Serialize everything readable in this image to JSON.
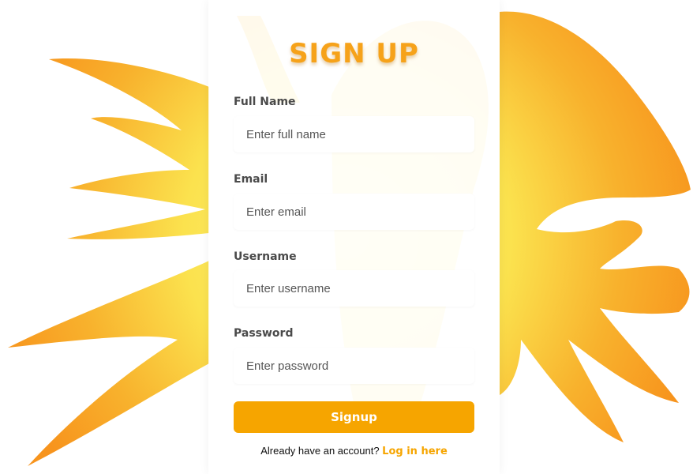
{
  "title": "SIGN UP",
  "fields": [
    {
      "label": "Full Name",
      "placeholder": "Enter full name",
      "value": ""
    },
    {
      "label": "Email",
      "placeholder": "Enter email",
      "value": ""
    },
    {
      "label": "Username",
      "placeholder": "Enter username",
      "value": ""
    },
    {
      "label": "Password",
      "placeholder": "Enter password",
      "value": ""
    }
  ],
  "signup_label": "Signup",
  "login_prompt": "Already have an account?",
  "login_link": "Log in here",
  "colors": {
    "accent": "#f6a500",
    "splash_outer": "#f7941d",
    "splash_inner": "#fbe85a",
    "label": "#4a4a4a"
  }
}
